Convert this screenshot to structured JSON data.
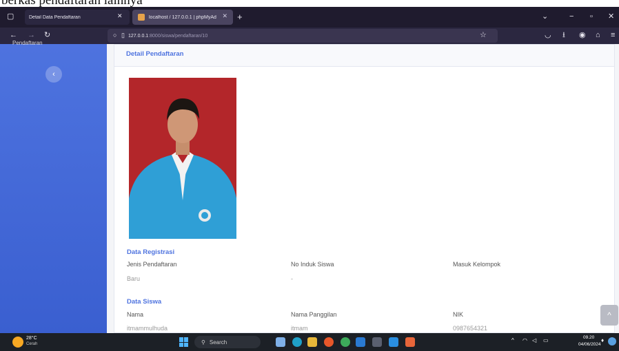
{
  "caption": "berkas pendaftaran lainnya",
  "browser": {
    "tabs": [
      {
        "label": "Detail Data Pendaftaran",
        "active": true
      },
      {
        "label": "localhost / 127.0.0.1 | phpMyAd",
        "active": false
      }
    ],
    "new_tab": "+",
    "url_host": "127.0.0.1",
    "url_path": ":8000/siswa/pendaftaran/10"
  },
  "sidebar": {
    "top_item": "Pendaftaran",
    "toggle_glyph": "‹",
    "color": "#4e73df"
  },
  "card": {
    "header": "Detail Pendaftaran",
    "photo_alt": "foto siswa"
  },
  "registration": {
    "title": "Data Registrasi",
    "fields": [
      {
        "label": "Jenis Pendaftaran",
        "value": "Baru"
      },
      {
        "label": "No Induk Siswa",
        "value": "-"
      },
      {
        "label": "Masuk Kelompok",
        "value": ""
      }
    ]
  },
  "student": {
    "title": "Data Siswa",
    "fields": [
      {
        "label": "Nama",
        "value": "itmammulhuda"
      },
      {
        "label": "Nama Panggilan",
        "value": "itmam"
      },
      {
        "label": "NIK",
        "value": "0987654321"
      }
    ]
  },
  "scroll_top_glyph": "^",
  "taskbar": {
    "temperature": "28°C",
    "weather": "Cerah",
    "search_label": "Search",
    "time": "09.20",
    "date": "04/06/2024"
  }
}
